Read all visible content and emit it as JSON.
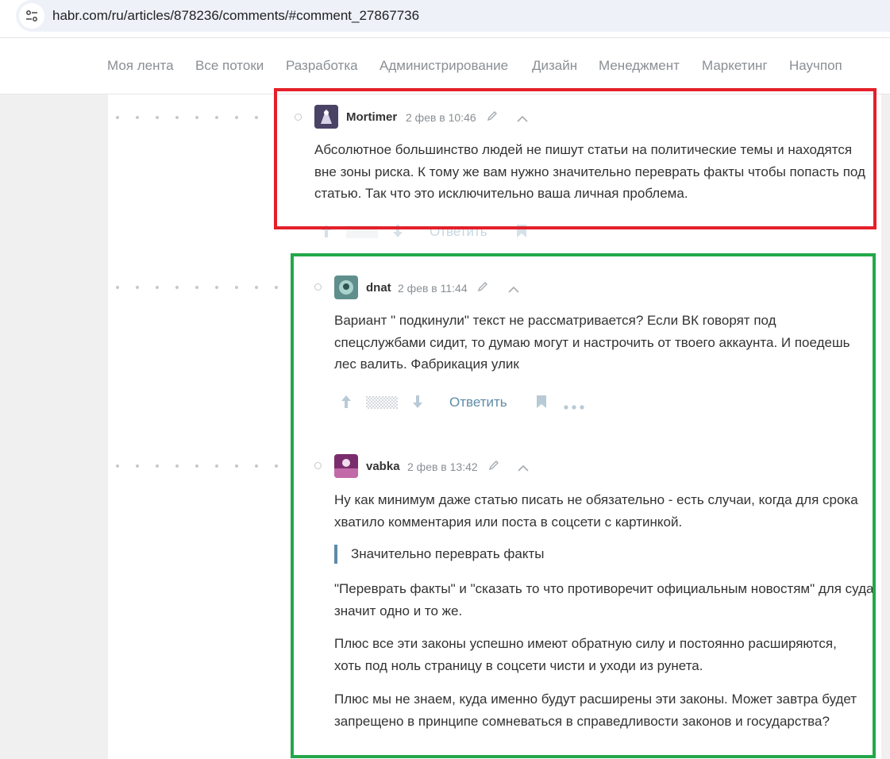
{
  "browser": {
    "url": "habr.com/ru/articles/878236/comments/#comment_27867736"
  },
  "nav": {
    "items": [
      "Моя лента",
      "Все потоки",
      "Разработка",
      "Администрирование",
      "Дизайн",
      "Менеджмент",
      "Маркетинг",
      "Научпоп"
    ]
  },
  "comments": [
    {
      "author": "Mortimer",
      "time": "2 фев в 10:46",
      "paragraphs": [
        "Абсолютное большинство людей не пишут статьи на политические темы и находятся вне зоны риска. К тому же вам нужно значительно переврать факты чтобы попасть под статью. Так что это исключительно ваша личная проблема."
      ],
      "reply_label": "Ответить"
    },
    {
      "author": "dnat",
      "time": "2 фев в 11:44",
      "paragraphs": [
        "Вариант \" подкинули\" текст не рассматривается? Если ВК говорят под спецслужбами сидит, то думаю могут и настрочить от твоего аккаунта. И поедешь лес валить. Фабрикация улик"
      ],
      "reply_label": "Ответить"
    },
    {
      "author": "vabka",
      "time": "2 фев в 13:42",
      "paragraphs": [
        "Ну как минимум даже статью писать не обязательно - есть случаи, когда для срока хватило комментария или поста в соцсети с картинкой.",
        "\"Переврать факты\" и \"сказать то что противоречит официальным новостям\" для суда значит одно и то же.",
        "Плюс все эти законы успешно имеют обратную силу и постоянно расширяются, хоть под ноль страницу в соцсети чисти и уходи из рунета.",
        "Плюс мы не знаем, куда именно будут расширены эти законы. Может завтра будет запрещено в принципе сомневаться в справедливости законов и государства?"
      ],
      "quote": "Значительно переврать факты"
    }
  ],
  "colors": {
    "link": "#5e8ba8",
    "highlight_red": "#e3202a",
    "highlight_green": "#22a84a"
  }
}
